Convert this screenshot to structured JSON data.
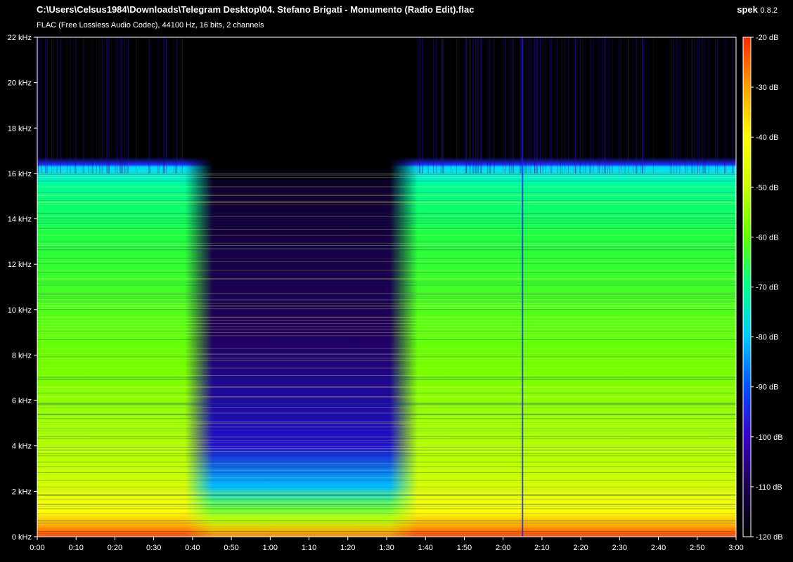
{
  "header": {
    "file_path": "C:\\Users\\Celsus1984\\Downloads\\Telegram Desktop\\04. Stefano Brigati - Monumento (Radio Edit).flac",
    "stream_info": "FLAC (Free Lossless Audio Codec), 44100 Hz, 16 bits, 2 channels",
    "app_name": "spek",
    "app_version": "0.8.2"
  },
  "axes": {
    "frequency_labels": [
      "22 kHz",
      "20 kHz",
      "18 kHz",
      "16 kHz",
      "14 kHz",
      "12 kHz",
      "10 kHz",
      "8 kHz",
      "6 kHz",
      "4 kHz",
      "2 kHz",
      "0 kHz"
    ],
    "time_labels": [
      "0:00",
      "0:10",
      "0:20",
      "0:30",
      "0:40",
      "0:50",
      "1:00",
      "1:10",
      "1:20",
      "1:30",
      "1:40",
      "1:50",
      "2:00",
      "2:10",
      "2:20",
      "2:30",
      "2:40",
      "2:50",
      "3:00"
    ],
    "db_labels": [
      "-20 dB",
      "-30 dB",
      "-40 dB",
      "-50 dB",
      "-60 dB",
      "-70 dB",
      "-80 dB",
      "-90 dB",
      "-100 dB",
      "-110 dB",
      "-120 dB"
    ]
  },
  "colors": {
    "background": "#000000",
    "axis": "#ffffff",
    "palette": [
      "#000000",
      "#1a0050",
      "#3a00c8",
      "#0050ff",
      "#00c8ff",
      "#00ff90",
      "#60ff00",
      "#c8ff00",
      "#ffff00",
      "#ffa000",
      "#ff2800"
    ]
  },
  "chart_data": {
    "type": "heatmap",
    "xlim_seconds": [
      0,
      180
    ],
    "ylim_khz": [
      0,
      22
    ],
    "dynamic_range_db": [
      -120,
      -20
    ],
    "x_ticks": [
      "0:00",
      "0:10",
      "0:20",
      "0:30",
      "0:40",
      "0:50",
      "1:00",
      "1:10",
      "1:20",
      "1:30",
      "1:40",
      "1:50",
      "2:00",
      "2:10",
      "2:20",
      "2:30",
      "2:40",
      "2:50",
      "3:00"
    ],
    "y_ticks": [
      "0 kHz",
      "2 kHz",
      "4 kHz",
      "6 kHz",
      "8 kHz",
      "10 kHz",
      "12 kHz",
      "14 kHz",
      "16 kHz",
      "18 kHz",
      "20 kHz",
      "22 kHz"
    ],
    "colorbar_ticks": [
      "-20 dB",
      "-30 dB",
      "-40 dB",
      "-50 dB",
      "-60 dB",
      "-70 dB",
      "-80 dB",
      "-90 dB",
      "-100 dB",
      "-110 dB",
      "-120 dB"
    ],
    "lowpass_cutoff_khz": 16,
    "breakdown_section_seconds": [
      38,
      98
    ]
  }
}
